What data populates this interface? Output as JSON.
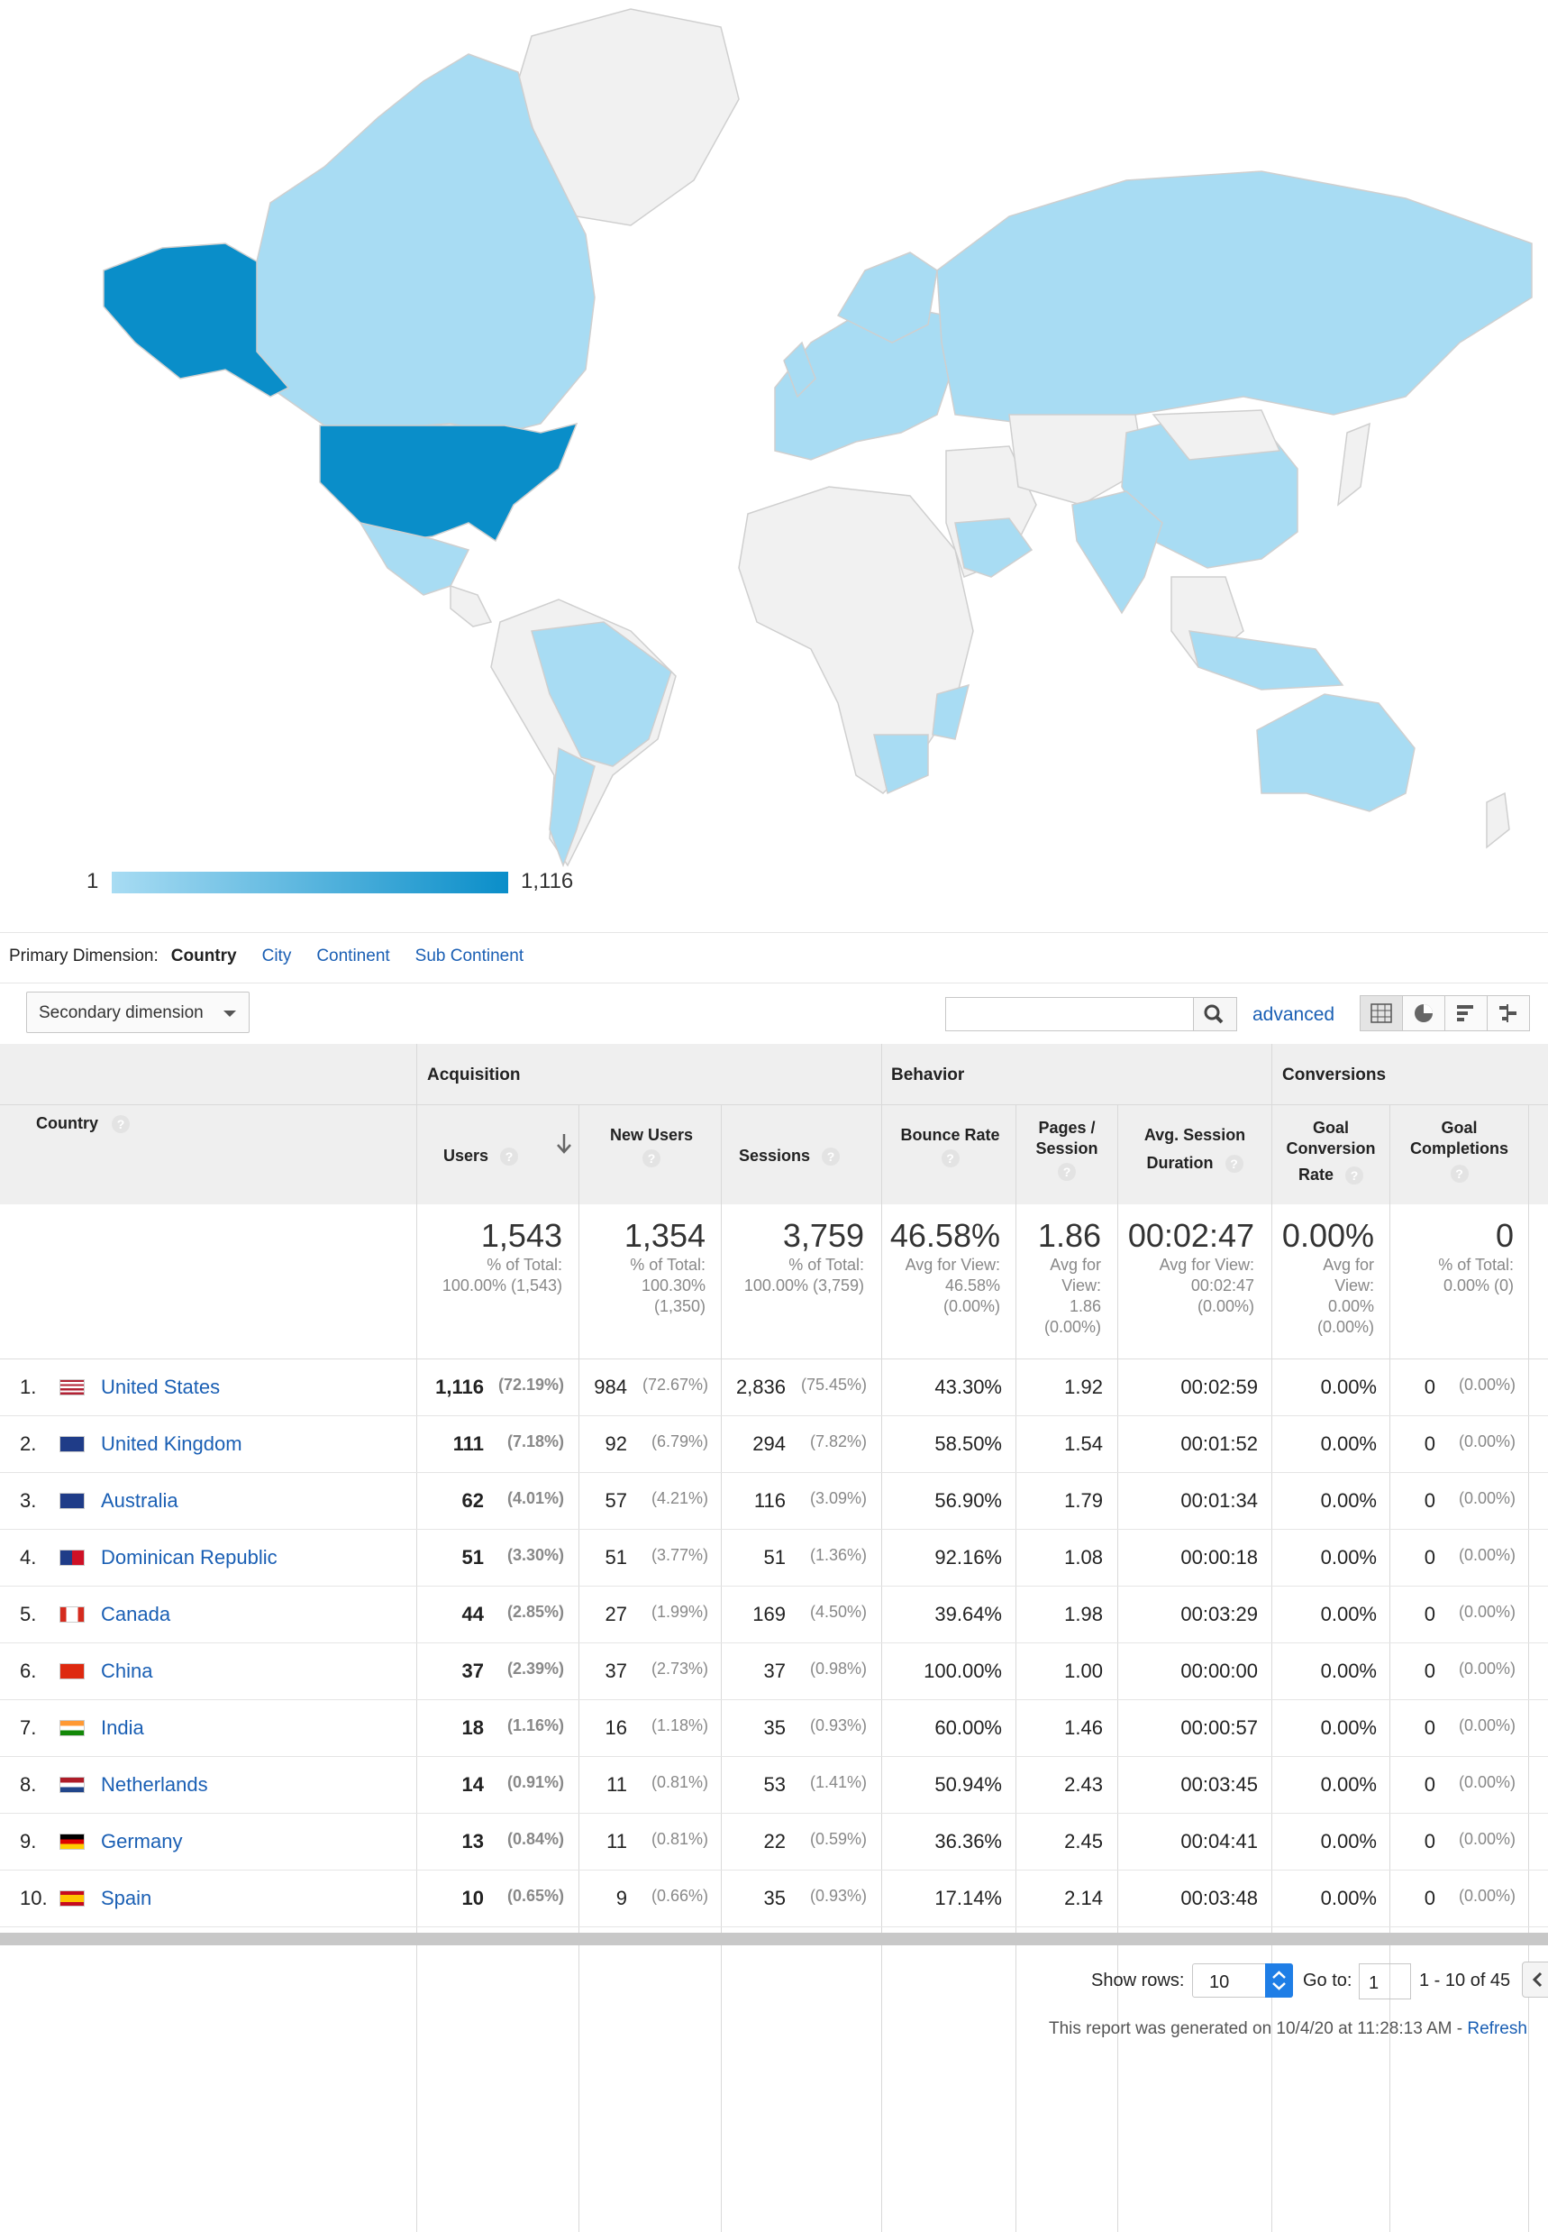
{
  "map": {
    "legend_min": "1",
    "legend_max": "1,116",
    "colors": {
      "low": "#a8dcf3",
      "high": "#0a8ec9",
      "none": "#f1f1f1",
      "border": "#cfcfcf"
    }
  },
  "dimensions": {
    "label": "Primary Dimension:",
    "active": "Country",
    "options": [
      "City",
      "Continent",
      "Sub Continent"
    ]
  },
  "toolbar": {
    "secondary_label": "Secondary dimension",
    "search_placeholder": "",
    "advanced_label": "advanced"
  },
  "table": {
    "groups": {
      "acquisition": "Acquisition",
      "behavior": "Behavior",
      "conversions": "Conversions"
    },
    "country_header": "Country",
    "columns": {
      "users": "Users",
      "new_users": "New Users",
      "sessions": "Sessions",
      "bounce": "Bounce Rate",
      "pages1": "Pages /",
      "pages2": "Session",
      "dur1": "Avg. Session",
      "dur2": "Duration",
      "gcr1": "Goal",
      "gcr2": "Conversion",
      "gcr3": "Rate",
      "gc1": "Goal",
      "gc2": "Completions"
    },
    "totals": {
      "users": "1,543",
      "users_sub1": "% of Total:",
      "users_sub2": "100.00% (1,543)",
      "new_users": "1,354",
      "new_users_sub1": "% of Total:",
      "new_users_sub2": "100.30%",
      "new_users_sub3": "(1,350)",
      "sessions": "3,759",
      "sessions_sub1": "% of Total:",
      "sessions_sub2": "100.00% (3,759)",
      "bounce": "46.58%",
      "bounce_sub1": "Avg for View:",
      "bounce_sub2": "46.58%",
      "bounce_sub3": "(0.00%)",
      "pages": "1.86",
      "pages_sub1": "Avg for",
      "pages_sub2": "View:",
      "pages_sub3": "1.86",
      "pages_sub4": "(0.00%)",
      "dur": "00:02:47",
      "dur_sub1": "Avg for View:",
      "dur_sub2": "00:02:47",
      "dur_sub3": "(0.00%)",
      "gcr": "0.00%",
      "gcr_sub1": "Avg for",
      "gcr_sub2": "View:",
      "gcr_sub3": "0.00%",
      "gcr_sub4": "(0.00%)",
      "gc": "0",
      "gc_sub1": "% of Total:",
      "gc_sub2": "0.00% (0)"
    },
    "rows": [
      {
        "idx": "1.",
        "country": "United States",
        "flag": "us",
        "users": "1,116",
        "users_pct": "(72.19%)",
        "new": "984",
        "new_pct": "(72.67%)",
        "sess": "2,836",
        "sess_pct": "(75.45%)",
        "bounce": "43.30%",
        "pages": "1.92",
        "dur": "00:02:59",
        "gcr": "0.00%",
        "gc": "0",
        "gc_pct": "(0.00%)"
      },
      {
        "idx": "2.",
        "country": "United Kingdom",
        "flag": "gb",
        "users": "111",
        "users_pct": "(7.18%)",
        "new": "92",
        "new_pct": "(6.79%)",
        "sess": "294",
        "sess_pct": "(7.82%)",
        "bounce": "58.50%",
        "pages": "1.54",
        "dur": "00:01:52",
        "gcr": "0.00%",
        "gc": "0",
        "gc_pct": "(0.00%)"
      },
      {
        "idx": "3.",
        "country": "Australia",
        "flag": "au",
        "users": "62",
        "users_pct": "(4.01%)",
        "new": "57",
        "new_pct": "(4.21%)",
        "sess": "116",
        "sess_pct": "(3.09%)",
        "bounce": "56.90%",
        "pages": "1.79",
        "dur": "00:01:34",
        "gcr": "0.00%",
        "gc": "0",
        "gc_pct": "(0.00%)"
      },
      {
        "idx": "4.",
        "country": "Dominican Republic",
        "flag": "do",
        "users": "51",
        "users_pct": "(3.30%)",
        "new": "51",
        "new_pct": "(3.77%)",
        "sess": "51",
        "sess_pct": "(1.36%)",
        "bounce": "92.16%",
        "pages": "1.08",
        "dur": "00:00:18",
        "gcr": "0.00%",
        "gc": "0",
        "gc_pct": "(0.00%)"
      },
      {
        "idx": "5.",
        "country": "Canada",
        "flag": "ca",
        "users": "44",
        "users_pct": "(2.85%)",
        "new": "27",
        "new_pct": "(1.99%)",
        "sess": "169",
        "sess_pct": "(4.50%)",
        "bounce": "39.64%",
        "pages": "1.98",
        "dur": "00:03:29",
        "gcr": "0.00%",
        "gc": "0",
        "gc_pct": "(0.00%)"
      },
      {
        "idx": "6.",
        "country": "China",
        "flag": "cn",
        "users": "37",
        "users_pct": "(2.39%)",
        "new": "37",
        "new_pct": "(2.73%)",
        "sess": "37",
        "sess_pct": "(0.98%)",
        "bounce": "100.00%",
        "pages": "1.00",
        "dur": "00:00:00",
        "gcr": "0.00%",
        "gc": "0",
        "gc_pct": "(0.00%)"
      },
      {
        "idx": "7.",
        "country": "India",
        "flag": "in",
        "users": "18",
        "users_pct": "(1.16%)",
        "new": "16",
        "new_pct": "(1.18%)",
        "sess": "35",
        "sess_pct": "(0.93%)",
        "bounce": "60.00%",
        "pages": "1.46",
        "dur": "00:00:57",
        "gcr": "0.00%",
        "gc": "0",
        "gc_pct": "(0.00%)"
      },
      {
        "idx": "8.",
        "country": "Netherlands",
        "flag": "nl",
        "users": "14",
        "users_pct": "(0.91%)",
        "new": "11",
        "new_pct": "(0.81%)",
        "sess": "53",
        "sess_pct": "(1.41%)",
        "bounce": "50.94%",
        "pages": "2.43",
        "dur": "00:03:45",
        "gcr": "0.00%",
        "gc": "0",
        "gc_pct": "(0.00%)"
      },
      {
        "idx": "9.",
        "country": "Germany",
        "flag": "de",
        "users": "13",
        "users_pct": "(0.84%)",
        "new": "11",
        "new_pct": "(0.81%)",
        "sess": "22",
        "sess_pct": "(0.59%)",
        "bounce": "36.36%",
        "pages": "2.45",
        "dur": "00:04:41",
        "gcr": "0.00%",
        "gc": "0",
        "gc_pct": "(0.00%)"
      },
      {
        "idx": "10.",
        "country": "Spain",
        "flag": "es",
        "users": "10",
        "users_pct": "(0.65%)",
        "new": "9",
        "new_pct": "(0.66%)",
        "sess": "35",
        "sess_pct": "(0.93%)",
        "bounce": "17.14%",
        "pages": "2.14",
        "dur": "00:03:48",
        "gcr": "0.00%",
        "gc": "0",
        "gc_pct": "(0.00%)"
      }
    ]
  },
  "pagination": {
    "show_rows_label": "Show rows:",
    "rows_value": "10",
    "goto_label": "Go to:",
    "goto_value": "1",
    "range": "1 - 10 of 45"
  },
  "footer": {
    "generated": "This report was generated on 10/4/20 at 11:28:13 AM - ",
    "refresh": "Refresh"
  }
}
